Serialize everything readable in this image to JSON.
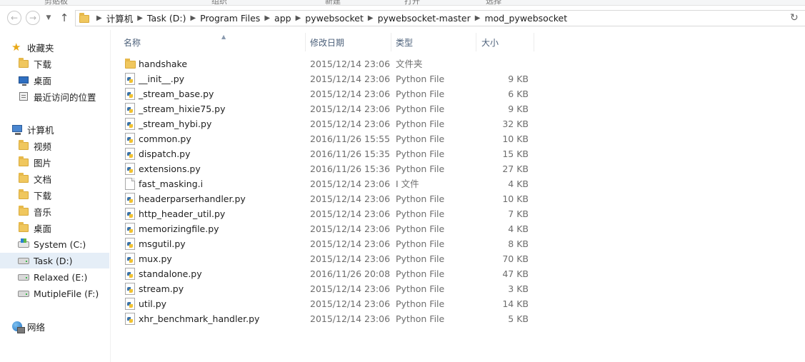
{
  "ribbon_strip": {
    "labels": [
      "剪贴板",
      "组织",
      "新建",
      "打开",
      "选择"
    ]
  },
  "address_bar": {
    "crumbs": [
      "计算机",
      "Task (D:)",
      "Program Files",
      "app",
      "pywebsocket",
      "pywebsocket-master",
      "mod_pywebsocket"
    ]
  },
  "nav": {
    "favorites": {
      "label": "收藏夹",
      "items": [
        {
          "label": "下载",
          "icon": "download-folder-icon"
        },
        {
          "label": "桌面",
          "icon": "desktop-icon"
        },
        {
          "label": "最近访问的位置",
          "icon": "recent-places-icon"
        }
      ]
    },
    "computer": {
      "label": "计算机",
      "items": [
        {
          "label": "视频",
          "icon": "videos-folder-icon"
        },
        {
          "label": "图片",
          "icon": "pictures-folder-icon"
        },
        {
          "label": "文档",
          "icon": "documents-folder-icon"
        },
        {
          "label": "下载",
          "icon": "downloads-folder-icon"
        },
        {
          "label": "音乐",
          "icon": "music-folder-icon"
        },
        {
          "label": "桌面",
          "icon": "desktop-folder-icon"
        },
        {
          "label": "System (C:)",
          "icon": "system-drive-icon"
        },
        {
          "label": "Task (D:)",
          "icon": "drive-icon",
          "selected": true
        },
        {
          "label": "Relaxed (E:)",
          "icon": "drive-icon"
        },
        {
          "label": "MutipleFile (F:)",
          "icon": "drive-icon"
        }
      ]
    },
    "network": {
      "label": "网络"
    }
  },
  "columns": {
    "name": "名称",
    "date": "修改日期",
    "type": "类型",
    "size": "大小"
  },
  "files": [
    {
      "name": "handshake",
      "date": "2015/12/14 23:06",
      "type": "文件夹",
      "size": "",
      "kind": "folder"
    },
    {
      "name": "__init__.py",
      "date": "2015/12/14 23:06",
      "type": "Python File",
      "size": "9 KB",
      "kind": "py"
    },
    {
      "name": "_stream_base.py",
      "date": "2015/12/14 23:06",
      "type": "Python File",
      "size": "6 KB",
      "kind": "py"
    },
    {
      "name": "_stream_hixie75.py",
      "date": "2015/12/14 23:06",
      "type": "Python File",
      "size": "9 KB",
      "kind": "py"
    },
    {
      "name": "_stream_hybi.py",
      "date": "2015/12/14 23:06",
      "type": "Python File",
      "size": "32 KB",
      "kind": "py"
    },
    {
      "name": "common.py",
      "date": "2016/11/26 15:55",
      "type": "Python File",
      "size": "10 KB",
      "kind": "py"
    },
    {
      "name": "dispatch.py",
      "date": "2016/11/26 15:35",
      "type": "Python File",
      "size": "15 KB",
      "kind": "py"
    },
    {
      "name": "extensions.py",
      "date": "2016/11/26 15:36",
      "type": "Python File",
      "size": "27 KB",
      "kind": "py"
    },
    {
      "name": "fast_masking.i",
      "date": "2015/12/14 23:06",
      "type": "I 文件",
      "size": "4 KB",
      "kind": "file"
    },
    {
      "name": "headerparserhandler.py",
      "date": "2015/12/14 23:06",
      "type": "Python File",
      "size": "10 KB",
      "kind": "py"
    },
    {
      "name": "http_header_util.py",
      "date": "2015/12/14 23:06",
      "type": "Python File",
      "size": "7 KB",
      "kind": "py"
    },
    {
      "name": "memorizingfile.py",
      "date": "2015/12/14 23:06",
      "type": "Python File",
      "size": "4 KB",
      "kind": "py"
    },
    {
      "name": "msgutil.py",
      "date": "2015/12/14 23:06",
      "type": "Python File",
      "size": "8 KB",
      "kind": "py"
    },
    {
      "name": "mux.py",
      "date": "2015/12/14 23:06",
      "type": "Python File",
      "size": "70 KB",
      "kind": "py"
    },
    {
      "name": "standalone.py",
      "date": "2016/11/26 20:08",
      "type": "Python File",
      "size": "47 KB",
      "kind": "py"
    },
    {
      "name": "stream.py",
      "date": "2015/12/14 23:06",
      "type": "Python File",
      "size": "3 KB",
      "kind": "py"
    },
    {
      "name": "util.py",
      "date": "2015/12/14 23:06",
      "type": "Python File",
      "size": "14 KB",
      "kind": "py"
    },
    {
      "name": "xhr_benchmark_handler.py",
      "date": "2015/12/14 23:06",
      "type": "Python File",
      "size": "5 KB",
      "kind": "py"
    }
  ]
}
